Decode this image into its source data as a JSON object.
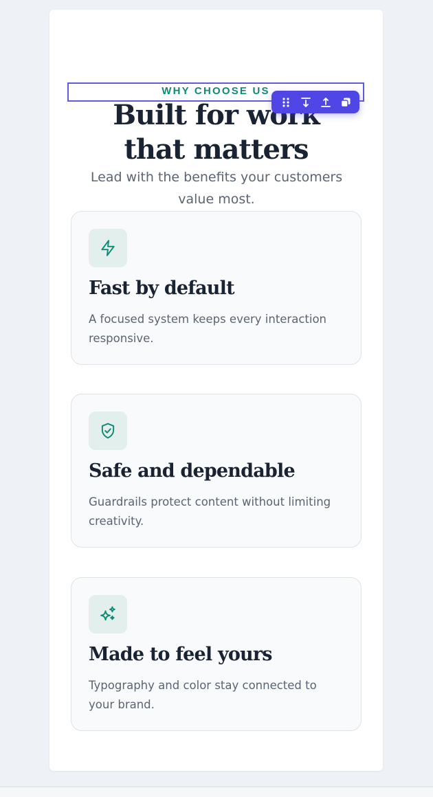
{
  "section": {
    "eyebrow": "WHY CHOOSE US",
    "title_line1": "Built for work",
    "title_line2": "that matters",
    "subtitle": "Lead with the benefits your customers value most."
  },
  "toolbar": {
    "buttons": [
      {
        "icon": "drag-handle-icon"
      },
      {
        "icon": "move-down-icon"
      },
      {
        "icon": "move-up-icon"
      },
      {
        "icon": "duplicate-icon"
      }
    ]
  },
  "cards": [
    {
      "icon": "lightning-icon",
      "title": "Fast by default",
      "text": "A focused system keeps every interaction responsive."
    },
    {
      "icon": "shield-check-icon",
      "title": "Safe and dependable",
      "text": "Guardrails protect content without limiting creativity."
    },
    {
      "icon": "sparkles-icon",
      "title": "Made to feel yours",
      "text": "Typography and color stay connected to your brand."
    }
  ],
  "colors": {
    "accent": "#0f8a76",
    "selection": "#5b5be6",
    "toolbar_bg": "#4f46e5",
    "heading": "#1a2332",
    "body_text": "#5b6472",
    "icon_tile": "#e2efec"
  }
}
